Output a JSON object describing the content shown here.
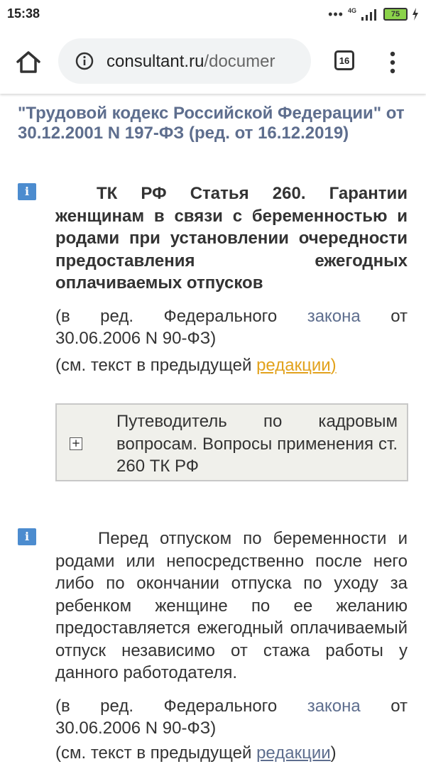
{
  "status_bar": {
    "time": "15:38",
    "network": "4G",
    "battery": "75"
  },
  "browser": {
    "url_domain": "consultant.ru",
    "url_path": "/documer",
    "tab_count": "16"
  },
  "document": {
    "title": "\"Трудовой кодекс Российской Федерации\" от 30.12.2001 N 197-ФЗ (ред. от 16.12.2019)",
    "article_heading": "ТК РФ Статья 260. Гарантии женщинам в связи с беременностью и родами при установлении очередности предоставления ежегодных оплачиваемых отпусков",
    "amendment1": {
      "prefix": "(в ред. Федерального",
      "link": "закона",
      "suffix": "от",
      "line2": "30.06.2006 N 90-ФЗ)"
    },
    "see_text1": {
      "prefix": "(см. текст в предыдущей ",
      "link": "редакции",
      "suffix": ")"
    },
    "guide_box": {
      "button": "+",
      "text": "Путеводитель по кадровым вопросам. Вопросы применения ст. 260 ТК РФ"
    },
    "body": "Перед отпуском по беременности и родами или непосредственно после него либо по окончании отпуска по уходу за ребенком женщине по ее желанию предоставляется ежегодный оплачиваемый отпуск независимо от стажа работы у данного работодателя.",
    "amendment2": {
      "prefix": "(в ред. Федерального",
      "link": "закона",
      "suffix": "от",
      "line2": "30.06.2006 N 90-ФЗ)"
    },
    "see_text2": {
      "prefix": "(см. текст в предыдущей ",
      "link": "редакции",
      "suffix": ")"
    },
    "info_icon_label": "i"
  },
  "colors": {
    "title": "#5e6e8e",
    "link": "#5e6e8e",
    "orange_link": "#e2a21d",
    "info_icon": "#4c8ccf",
    "battery": "#8bd34a"
  },
  "icons": [
    "home-icon",
    "info-circle-icon",
    "tab-switcher-icon",
    "more-vert-icon",
    "signal-icon",
    "battery-icon",
    "charging-icon",
    "paragraph-info-icon",
    "expand-plus-icon"
  ]
}
